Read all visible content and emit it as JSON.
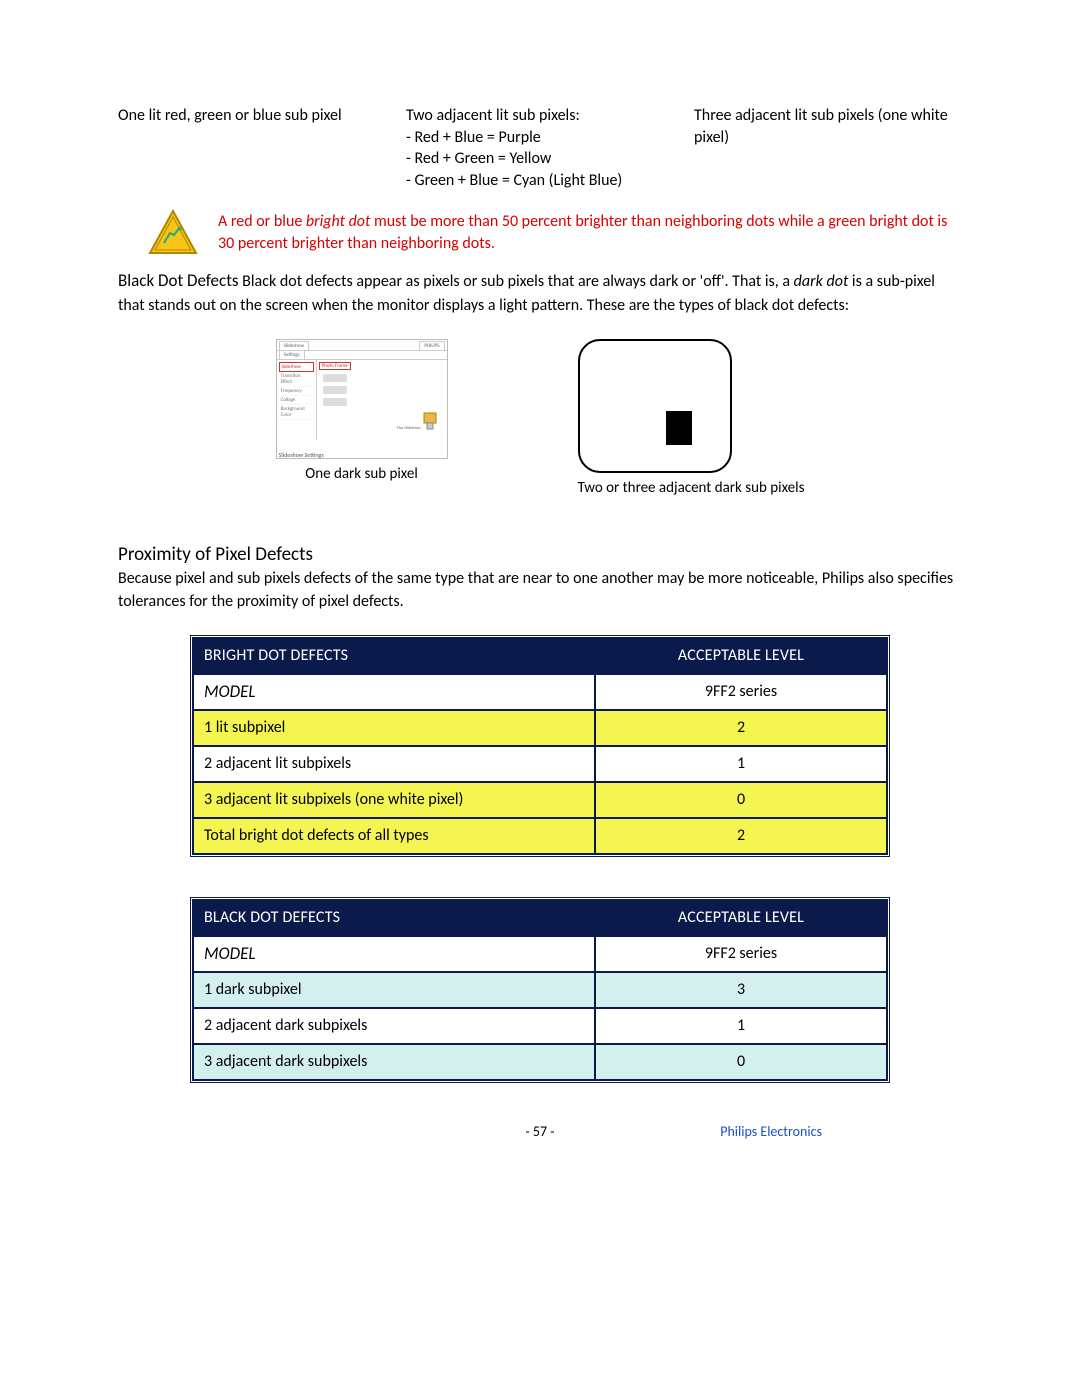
{
  "top_columns": {
    "left": "One lit red, green or blue sub pixel",
    "mid": "Two adjacent lit sub pixels:\n- Red + Blue = Purple\n- Red + Green = Yellow\n- Green + Blue = Cyan (Light Blue)",
    "right": "Three adjacent lit sub pixels (one white pixel)"
  },
  "warning": {
    "pre": "A red or blue ",
    "em": "bright dot",
    "rest": " must be more than 50 percent brighter than neighboring dots while a green bright dot is 30 percent brighter than neighboring dots."
  },
  "black_dot_section": {
    "lead": "Black Dot Defects",
    "body_a": "   Black dot defects appear as pixels or sub pixels that are always dark or 'off'. That is, a ",
    "em": "dark dot",
    "body_b": " is a sub-pixel that stands out on the screen when the monitor displays a light pattern. These are the types of black dot defects:"
  },
  "mini_ui": {
    "tab1": "Slideshow",
    "tab2": "Settings",
    "right_tab": "PHILIPS",
    "side_items": [
      "Sideshow",
      "Transition Effect",
      "Frequency",
      "Collage",
      "Background Color"
    ],
    "side_item2": "Photo Frame",
    "badge_label": "Play Slideshow",
    "caption": "Slideshow Settings"
  },
  "fig_captions": {
    "one": "One dark sub pixel",
    "two": "Two or three adjacent dark sub pixels"
  },
  "proximity": {
    "heading": "Proximity of Pixel Defects",
    "para": "Because pixel and sub pixels defects of the same type that are near to one another may be more noticeable, Philips also specifies tolerances for the proximity of pixel defects."
  },
  "table_bright": {
    "h1": "BRIGHT DOT DEFECTS",
    "h2": "ACCEPTABLE LEVEL",
    "model_label": "MODEL",
    "model_value": "9FF2 series",
    "rows": [
      {
        "label": "1 lit subpixel",
        "value": "2",
        "hl": true
      },
      {
        "label": "2 adjacent lit subpixels",
        "value": "1",
        "hl": false
      },
      {
        "label": "3 adjacent lit subpixels (one white pixel)",
        "value": "0",
        "hl": true
      },
      {
        "label": "Total bright dot defects of all types",
        "value": "2",
        "hl": true
      }
    ]
  },
  "table_black": {
    "h1": "BLACK DOT DEFECTS",
    "h2": "ACCEPTABLE LEVEL",
    "model_label": "MODEL",
    "model_value": "9FF2 series",
    "rows": [
      {
        "label": "1 dark subpixel",
        "value": "3",
        "hl": true
      },
      {
        "label": "2 adjacent dark subpixels",
        "value": "1",
        "hl": false
      },
      {
        "label": "3 adjacent dark subpixels",
        "value": "0",
        "hl": true
      }
    ]
  },
  "footer": {
    "page": "- 57 -",
    "brand": "Philips Electronics"
  }
}
